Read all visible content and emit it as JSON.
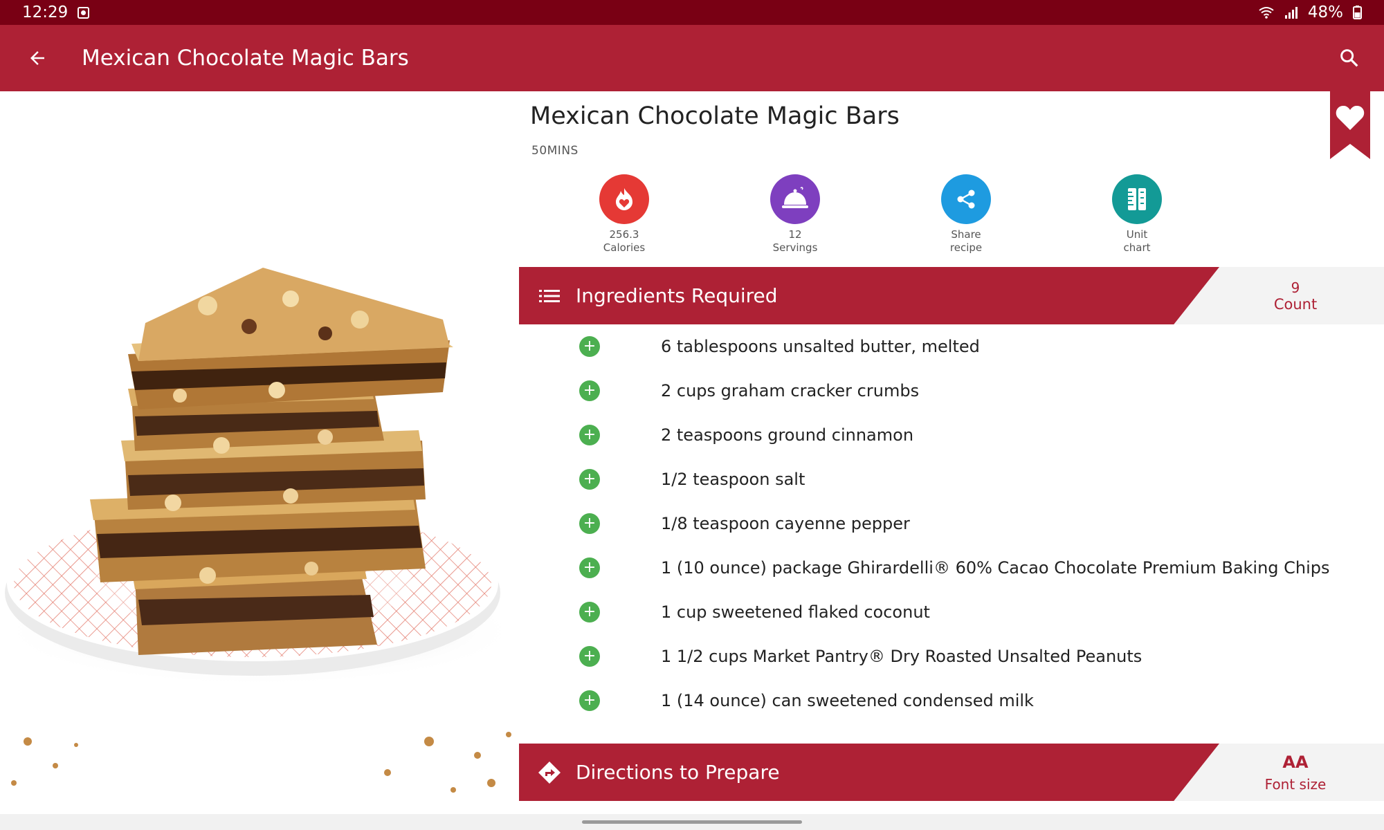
{
  "status_bar": {
    "time": "12:29",
    "battery": "48%"
  },
  "app_bar": {
    "title": "Mexican Chocolate Magic Bars"
  },
  "recipe": {
    "title": "Mexican Chocolate Magic Bars",
    "time": "50MINS",
    "stats": [
      {
        "value": "256.3",
        "label": "Calories",
        "icon": "calories-icon",
        "color": "#e53935"
      },
      {
        "value": "12",
        "label": "Servings",
        "icon": "servings-icon",
        "color": "#7e3fbf"
      },
      {
        "value": "Share",
        "label": "recipe",
        "icon": "share-icon",
        "color": "#1e9be0"
      },
      {
        "value": "Unit",
        "label": "chart",
        "icon": "unit-chart-icon",
        "color": "#139a96"
      }
    ]
  },
  "ingredients_section": {
    "title": "Ingredients Required",
    "count": "9",
    "count_label": "Count",
    "items": [
      "6 tablespoons unsalted butter, melted",
      "2 cups graham cracker crumbs",
      "2 teaspoons ground cinnamon",
      "1/2 teaspoon salt",
      "1/8 teaspoon cayenne pepper",
      "1 (10 ounce) package Ghirardelli® 60% Cacao Chocolate Premium Baking Chips",
      "1 cup sweetened flaked coconut",
      "1 1/2 cups Market Pantry® Dry Roasted Unsalted Peanuts",
      "1 (14 ounce) can sweetened condensed milk"
    ]
  },
  "directions_section": {
    "title": "Directions to Prepare",
    "font_size_icon": "AA",
    "font_size_label": "Font size"
  },
  "colors": {
    "status_bar": "#790014",
    "primary": "#ae2135",
    "add": "#4caf50"
  }
}
